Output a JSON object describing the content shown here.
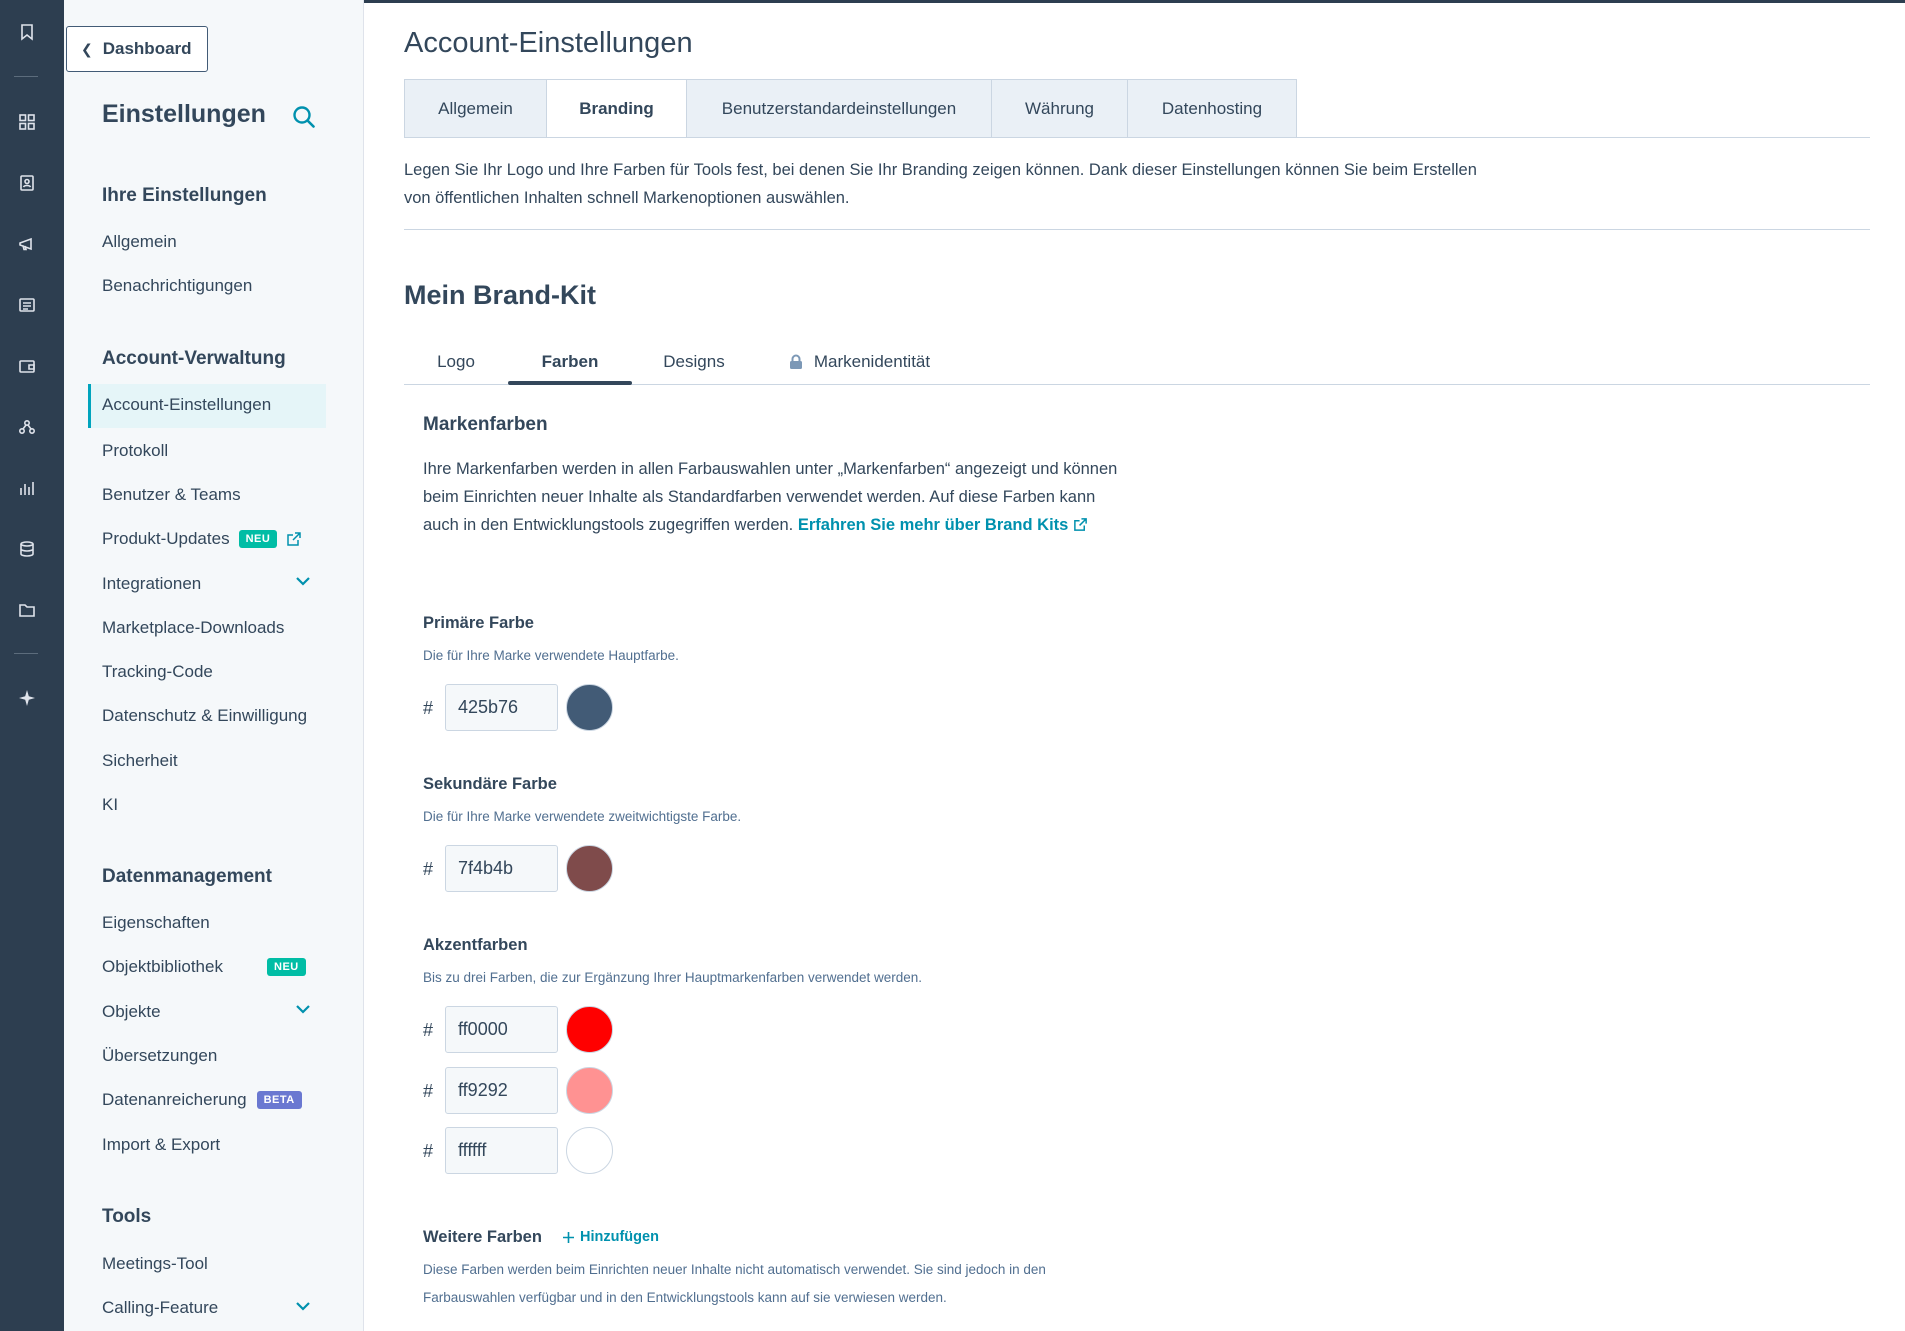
{
  "rail": {
    "icons": [
      "bookmark-icon",
      "grid-icon",
      "contacts-icon",
      "megaphone-icon",
      "content-icon",
      "commerce-icon",
      "service-icon",
      "reports-icon",
      "database-icon",
      "folder-icon",
      "sparkle-icon"
    ]
  },
  "sidebar": {
    "back_label": "Dashboard",
    "title": "Einstellungen",
    "groups": {
      "ihre": "Ihre Einstellungen",
      "account": "Account-Verwaltung",
      "daten": "Datenmanagement",
      "tools": "Tools"
    },
    "items": {
      "allgemein": "Allgemein",
      "benachrichtigungen": "Benachrichtigungen",
      "account_einstellungen": "Account-Einstellungen",
      "protokoll": "Protokoll",
      "benutzer_teams": "Benutzer & Teams",
      "produkt_updates": "Produkt-Updates",
      "integrationen": "Integrationen",
      "marketplace": "Marketplace-Downloads",
      "tracking": "Tracking-Code",
      "datenschutz": "Datenschutz & Einwilligung",
      "sicherheit": "Sicherheit",
      "ki": "KI",
      "eigenschaften": "Eigenschaften",
      "objektbibliothek": "Objektbibliothek",
      "objekte": "Objekte",
      "uebersetzungen": "Übersetzungen",
      "datenanreicherung": "Datenanreicherung",
      "import_export": "Import & Export",
      "meetings": "Meetings-Tool",
      "calling": "Calling-Feature"
    },
    "badges": {
      "neu": "NEU",
      "beta": "BETA"
    }
  },
  "main": {
    "title": "Account-Einstellungen",
    "tabs": [
      "Allgemein",
      "Branding",
      "Benutzerstandardeinstellungen",
      "Währung",
      "Datenhosting"
    ],
    "intro": "Legen Sie Ihr Logo und Ihre Farben für Tools fest, bei denen Sie Ihr Branding zeigen können. Dank dieser Einstellungen können Sie beim Erstellen von öffentlichen Inhalten schnell Markenoptionen auswählen.",
    "brandkit_title": "Mein Brand-Kit",
    "subtabs": [
      "Logo",
      "Farben",
      "Designs",
      "Markenidentität"
    ],
    "markenfarben": {
      "title": "Markenfarben",
      "text": "Ihre Markenfarben werden in allen Farbauswahlen unter „Markenfarben“ angezeigt und können beim Einrichten neuer Inhalte als Standardfarben verwendet werden. Auf diese Farben kann auch in den Entwicklungstools zugegriffen werden. ",
      "link": "Erfahren Sie mehr über Brand Kits"
    },
    "primary": {
      "label": "Primäre Farbe",
      "help": "Die für Ihre Marke verwendete Hauptfarbe.",
      "value": "425b76",
      "color": "#425b76"
    },
    "secondary": {
      "label": "Sekundäre Farbe",
      "help": "Die für Ihre Marke verwendete zweitwichtigste Farbe.",
      "value": "7f4b4b",
      "color": "#7f4b4b"
    },
    "accent": {
      "label": "Akzentfarben",
      "help": "Bis zu drei Farben, die zur Ergänzung Ihrer Hauptmarkenfarben verwendet werden.",
      "colors": [
        {
          "value": "ff0000",
          "color": "#ff0000"
        },
        {
          "value": "ff9292",
          "color": "#ff9292"
        },
        {
          "value": "ffffff",
          "color": "#ffffff"
        }
      ]
    },
    "hash": "#",
    "weitere": {
      "label": "Weitere Farben",
      "add": "Hinzufügen",
      "help": "Diese Farben werden beim Einrichten neuer Inhalte nicht automatisch verwendet. Sie sind jedoch in den Farbauswahlen verfügbar und in den Entwicklungstools kann auf sie verwiesen werden."
    }
  },
  "colors": {
    "accent": "#00a4bd",
    "link": "#0091ae",
    "text": "#33475b",
    "rail": "#2d3e50"
  }
}
